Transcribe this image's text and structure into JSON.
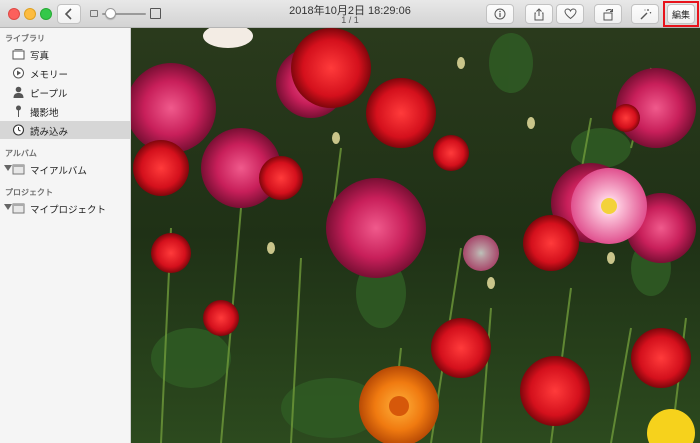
{
  "titlebar": {
    "date": "2018年10月2日 18:29:06",
    "count": "1 / 1"
  },
  "toolbar": {
    "edit_label": "編集",
    "icons": {
      "back": "back-chevron-icon",
      "info": "info-icon",
      "share": "share-icon",
      "favorite": "heart-icon",
      "rotate": "rotate-icon",
      "enhance": "magic-wand-icon"
    },
    "zoom_level": 0.1
  },
  "sidebar": {
    "library_header": "ライブラリ",
    "library_items": [
      {
        "label": "写真",
        "icon": "photos-icon"
      },
      {
        "label": "メモリー",
        "icon": "memories-icon"
      },
      {
        "label": "ピープル",
        "icon": "people-icon"
      },
      {
        "label": "撮影地",
        "icon": "places-pin-icon"
      },
      {
        "label": "読み込み",
        "icon": "imports-clock-icon",
        "selected": true
      }
    ],
    "album_header": "アルバム",
    "album_item": "マイアルバム",
    "project_header": "プロジェクト",
    "project_item": "マイプロジェクト"
  },
  "colors": {
    "highlight": "#e8131b",
    "selected_row": "#d6d6d6"
  }
}
